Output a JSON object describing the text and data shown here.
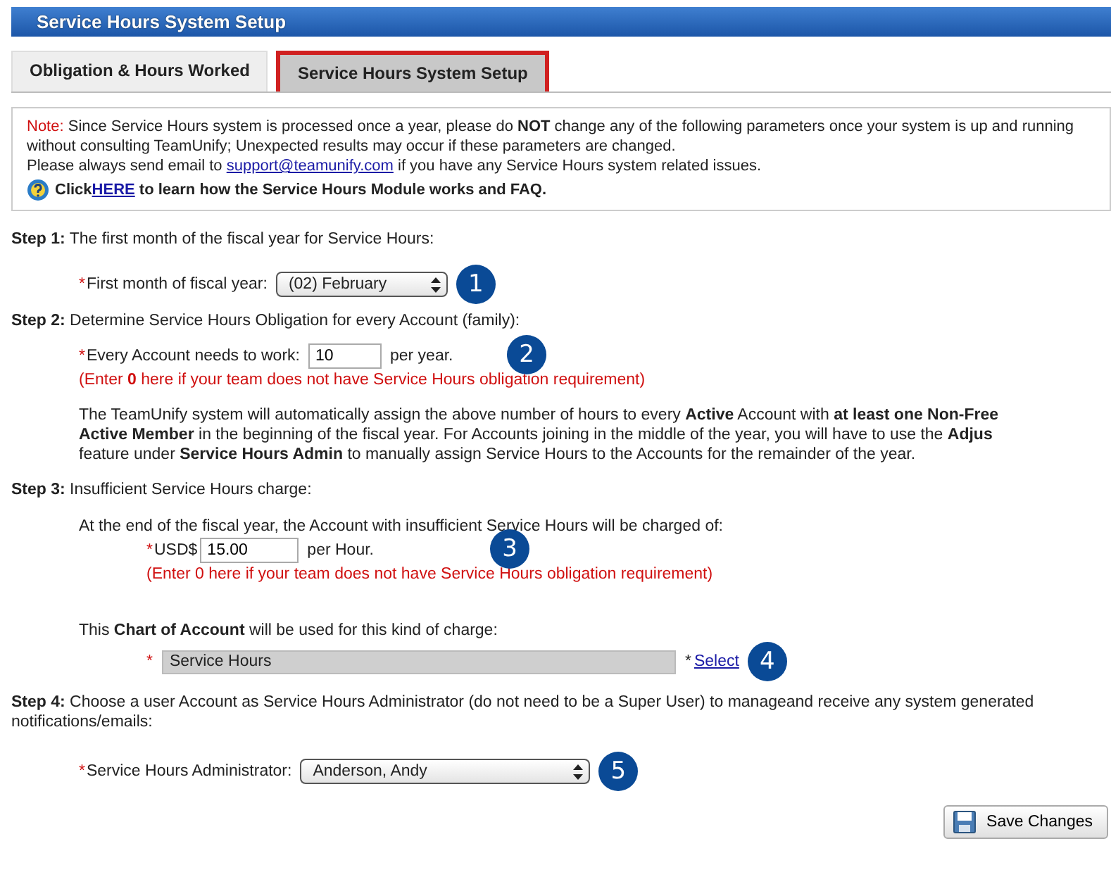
{
  "header": {
    "title": "Service Hours System Setup"
  },
  "tabs": [
    {
      "label": "Obligation & Hours Worked",
      "selected": false
    },
    {
      "label": "Service Hours System Setup",
      "selected": true
    }
  ],
  "note": {
    "label": "Note:",
    "text": "Since Service Hours system is processed once a year, please do **NOT** change any of the following parameters once your system is up and running without consulting TeamUnify; Unexpected results may occur if these parameters are changed.",
    "email_before": "Please always send email to",
    "email_link": "support@teamunify.com",
    "email_after": "if you have any Service Hours system related issues.",
    "help_before": "Click",
    "help_link": "HERE",
    "help_after": "to learn how the Service Hours Module works and FAQ."
  },
  "step1": {
    "label": "Step 1:",
    "text": "The first month of the fiscal year for Service Hours:",
    "marker": "*",
    "field_label": "First month of fiscal year:",
    "value": "(02) February",
    "callout": "1"
  },
  "step2": {
    "label": "Step 2:",
    "text": "Determine Service Hours Obligation for every Account (family):",
    "marker": "*",
    "field_label": "Every Account needs to work:",
    "value": "10",
    "unit": "per year.",
    "callout": "2",
    "hint": "(Enter **0** here if your team does not have Service Hours obligation requirement)",
    "info_lines": [
      "The TeamUnify system will automatically assign the above number of hours to every **Active** Account with **at least one Non-Free**",
      "**Active Member** in the beginning of the fiscal year. For Accounts joining in the middle of the year, you will have to use the **Adjus**",
      "feature under **Service Hours Admin** to manually assign Service Hours to the Accounts for the remainder of the year."
    ]
  },
  "step3": {
    "label": "Step 3:",
    "text": "Insufficient Service Hours charge:",
    "intro": "At the end of the fiscal year, the Account with insufficient Service Hours will be charged of:",
    "marker": "*",
    "field_label": "USD$",
    "value": "15.00",
    "unit": "per Hour.",
    "callout": "3",
    "hint": "(Enter 0 here if your team does not have Service Hours obligation requirement)",
    "account_text": "This **Chart of Account** will be used for this kind of charge:",
    "account_marker": "*",
    "account_value": "Service Hours",
    "select_marker": "*",
    "select_link": "Select",
    "account_callout": "4"
  },
  "step4": {
    "label": "Step 4:",
    "text": "Choose a user Account as Service Hours Administrator (do not need to be a Super User) to manageand receive any system generated notifications/emails:",
    "marker": "*",
    "field_label": "Service Hours Administrator:",
    "value": "Anderson, Andy",
    "callout": "5"
  },
  "save_button": {
    "label": "Save Changes"
  }
}
